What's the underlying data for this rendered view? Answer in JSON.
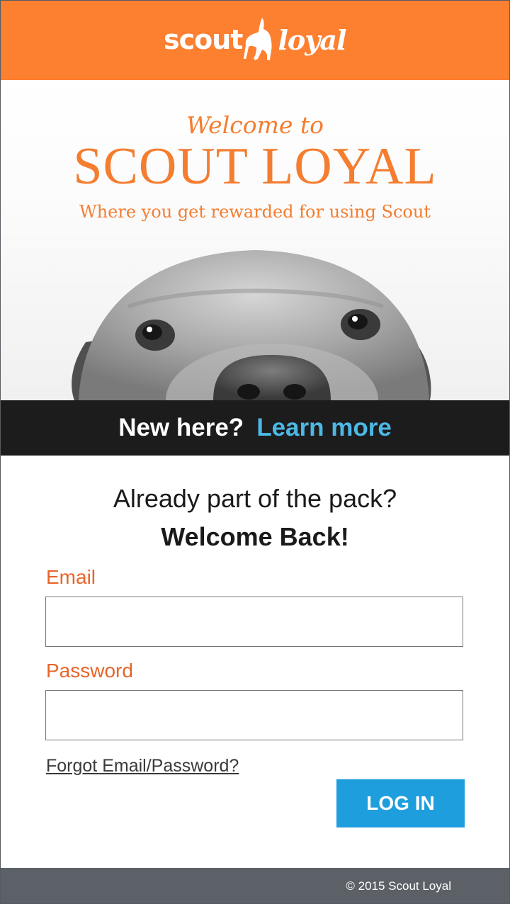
{
  "header": {
    "logo_word1": "scout",
    "logo_word2": "loyal",
    "brand_color": "#fd7f30"
  },
  "hero": {
    "welcome_small": "Welcome to",
    "welcome_big": "SCOUT LOYAL",
    "tagline": "Where you get rewarded for using Scout",
    "image": "dog-peeking-photo"
  },
  "banner": {
    "question": "New here?",
    "link": "Learn more"
  },
  "login": {
    "heading_line1": "Already part of the pack?",
    "heading_line2": "Welcome Back!",
    "email_label": "Email",
    "email_value": "",
    "password_label": "Password",
    "password_value": "",
    "forgot_link": "Forgot Email/Password?",
    "submit_label": "LOG IN",
    "button_color": "#1f9ede"
  },
  "footer": {
    "copyright": "© 2015 Scout Loyal"
  }
}
